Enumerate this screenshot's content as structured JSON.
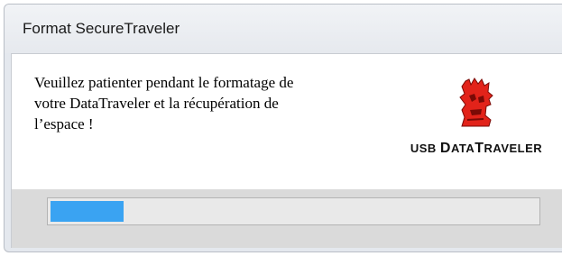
{
  "window": {
    "title": "Format SecureTraveler"
  },
  "message": {
    "text": "Veuillez patienter pendant le formatage de\nvotre DataTraveler et la récupération de\nl’espace !"
  },
  "logo": {
    "icon": "kingston-head-icon",
    "brand_prefix": "USB ",
    "brand_d": "D",
    "brand_ata": "ATA",
    "brand_t": "T",
    "brand_raveler": "RAVELER",
    "colors": {
      "mark": "#e2231a",
      "text": "#111111"
    }
  },
  "progress": {
    "fraction": 0.15,
    "color": "#3aa3f2"
  }
}
